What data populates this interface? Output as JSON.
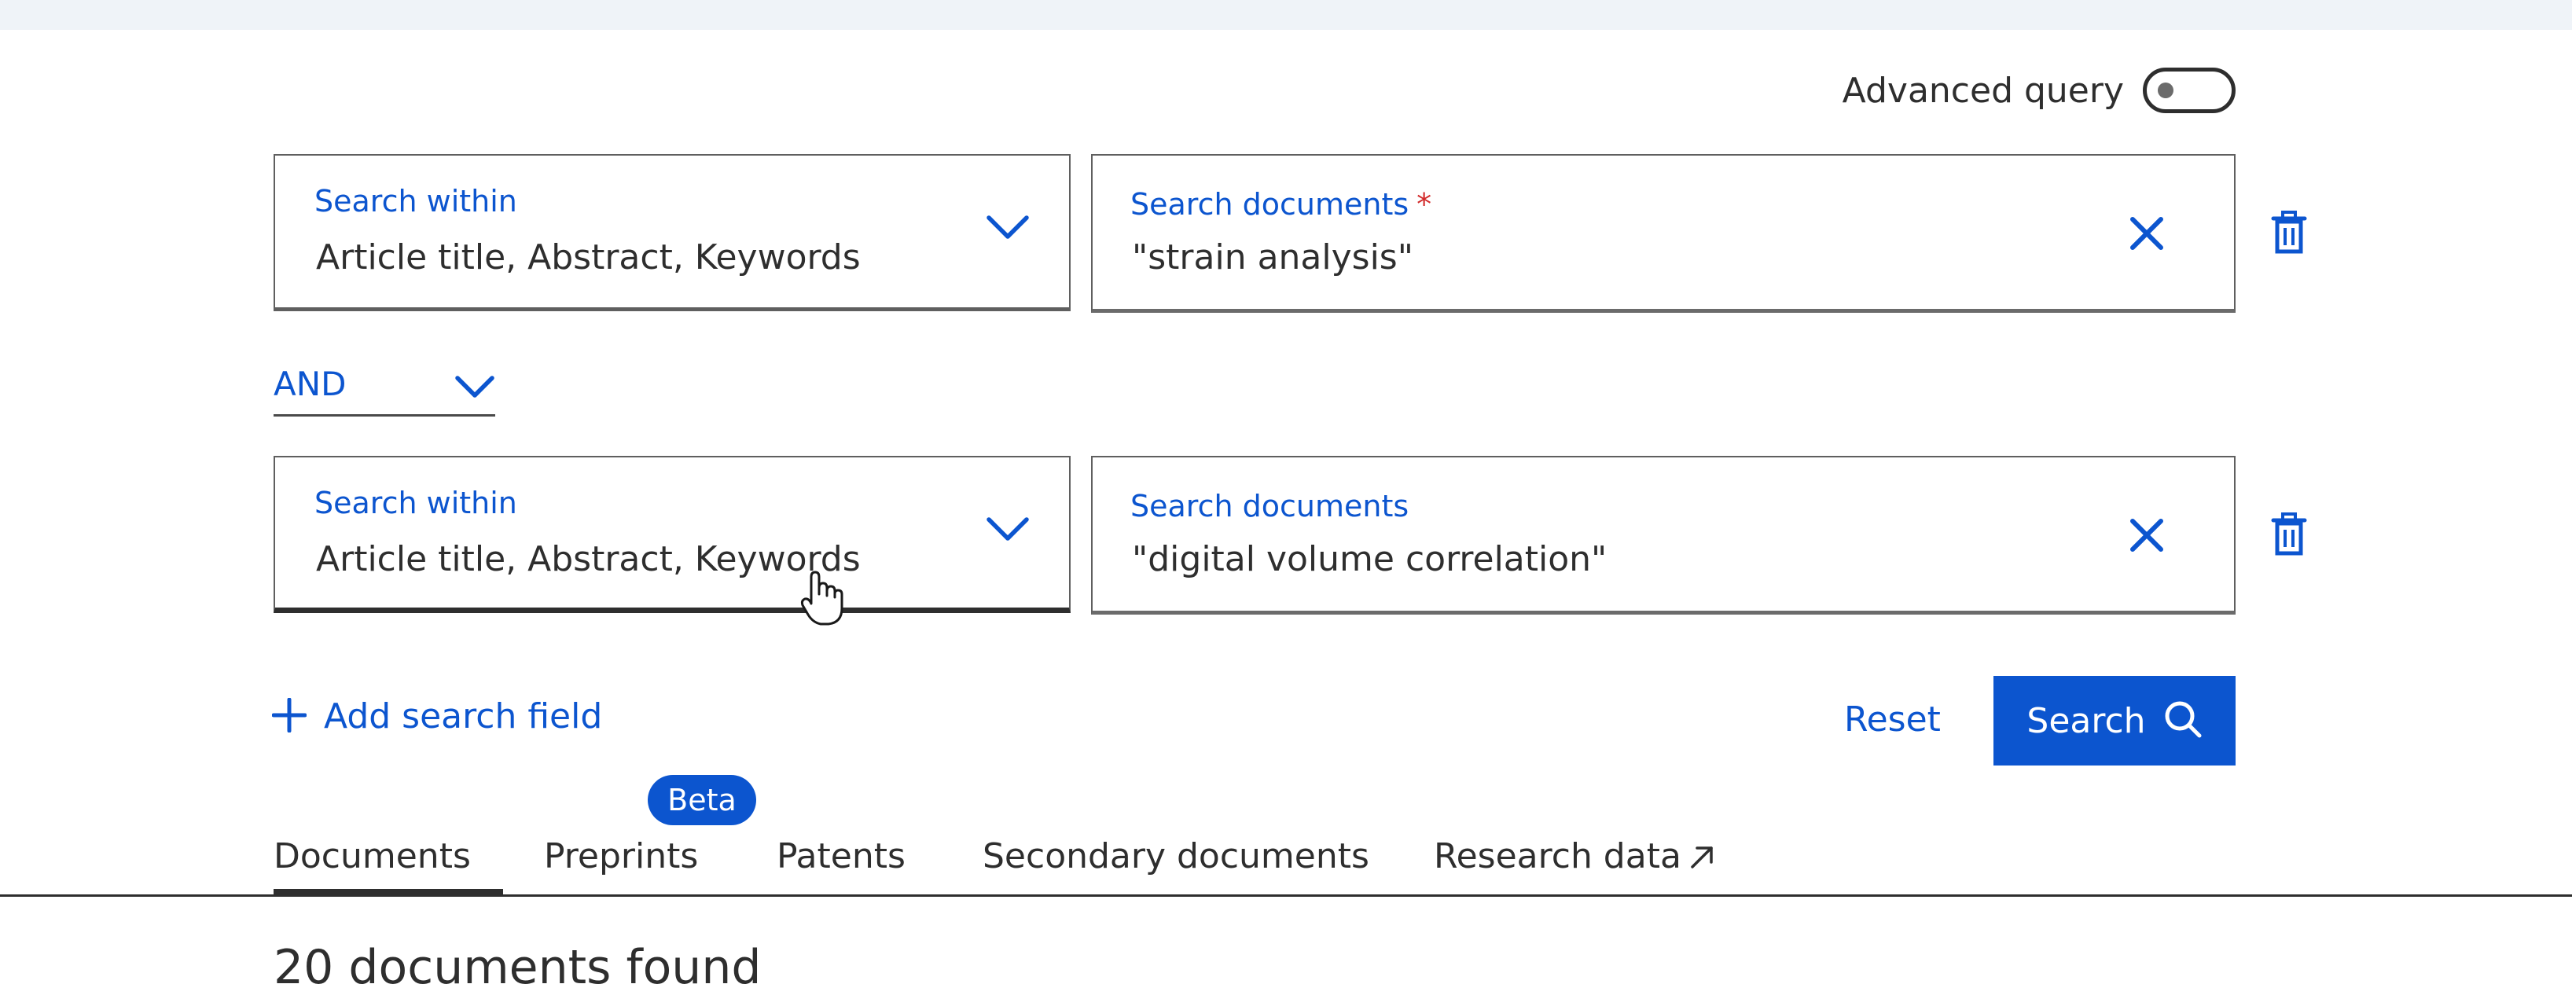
{
  "advanced_query": {
    "label": "Advanced query",
    "enabled": false
  },
  "rows": [
    {
      "search_within_label": "Search within",
      "search_within_value": "Article title, Abstract, Keywords",
      "search_documents_label": "Search documents",
      "required_mark": "*",
      "query_value": "\"strain analysis\""
    },
    {
      "search_within_label": "Search within",
      "search_within_value": "Article title, Abstract, Keywords",
      "search_documents_label": "Search documents",
      "query_value": "\"digital volume correlation\""
    }
  ],
  "operator": {
    "value": "AND"
  },
  "actions": {
    "add_field": "Add search field",
    "reset": "Reset",
    "search": "Search"
  },
  "tabs": {
    "items": [
      {
        "label": "Documents",
        "selected": true
      },
      {
        "label": "Preprints",
        "badge": "Beta"
      },
      {
        "label": "Patents"
      },
      {
        "label": "Secondary documents"
      },
      {
        "label": "Research data",
        "external": true
      }
    ]
  },
  "results": {
    "text": "20 documents found"
  },
  "colors": {
    "accent": "#0c55cf",
    "required": "#d22b2b",
    "text": "#2e2e2e",
    "topbar": "#eff3f8"
  },
  "icons": {
    "dropdown": "chevron-down-icon",
    "clear": "close-icon",
    "delete": "trash-icon",
    "add": "plus-icon",
    "search": "search-icon",
    "external": "external-link-icon"
  }
}
